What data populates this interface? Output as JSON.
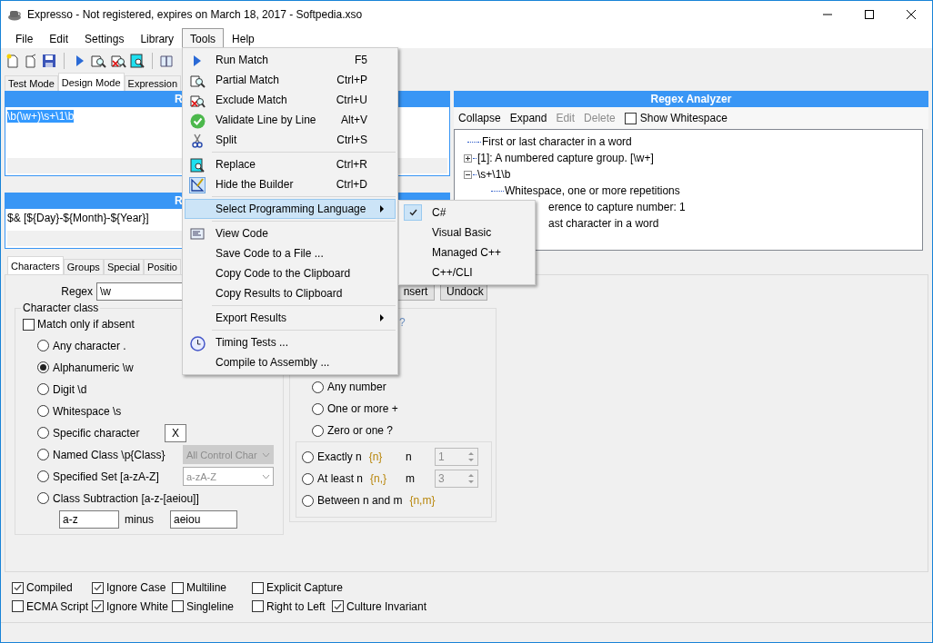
{
  "window": {
    "title": "Expresso - Not registered, expires on March 18, 2017 - Softpedia.xso"
  },
  "menu_bar": [
    {
      "label": "File",
      "selected": false
    },
    {
      "label": "Edit",
      "selected": false
    },
    {
      "label": "Settings",
      "selected": false
    },
    {
      "label": "Library",
      "selected": false
    },
    {
      "label": "Tools",
      "selected": true
    },
    {
      "label": "Help",
      "selected": false
    }
  ],
  "mode_tabs": [
    {
      "label": "Test Mode",
      "selected": false
    },
    {
      "label": "Design Mode",
      "selected": true
    },
    {
      "label": "Expression",
      "selected": false
    }
  ],
  "regex_panel": {
    "title": "R",
    "value": "\\b(\\w+)\\s+\\1\\b"
  },
  "replacement_panel": {
    "title": "R",
    "value": "$& [${Day}-${Month}-${Year}]"
  },
  "analyzer": {
    "title": "Regex Analyzer",
    "actions": [
      {
        "label": "Collapse",
        "disabled": false
      },
      {
        "label": "Expand",
        "disabled": false
      },
      {
        "label": "Edit",
        "disabled": true
      },
      {
        "label": "Delete",
        "disabled": true
      }
    ],
    "show_whitespace": {
      "label": "Show Whitespace",
      "checked": false
    },
    "tree": [
      {
        "label": "First or last character in a word"
      },
      {
        "label": "[1]: A numbered capture group. [\\w+]",
        "expanded": false
      },
      {
        "label": "\\s+\\1\\b",
        "expanded": true,
        "children": [
          {
            "label": "Whitespace, one or more repetitions",
            "kind": "plain"
          },
          {
            "label": "erence to capture number: 1",
            "kind": "covered"
          },
          {
            "label": "ast character in a word",
            "kind": "covered"
          }
        ]
      }
    ]
  },
  "builder": {
    "tabs": [
      {
        "label": "Characters",
        "selected": true
      },
      {
        "label": "Groups",
        "selected": false
      },
      {
        "label": "Special",
        "selected": false
      },
      {
        "label": "Positio",
        "selected": false
      }
    ],
    "regex_label": "Regex",
    "regex_value": "\\w",
    "buttons": [
      "nsert",
      "Undock"
    ],
    "character_class": {
      "title": "Character class",
      "absent": {
        "label": "Match only if absent",
        "checked": false
      },
      "options": [
        {
          "label": "Any character .",
          "selected": false,
          "kind": "plain"
        },
        {
          "label": "Alphanumeric \\w",
          "selected": true,
          "kind": "plain"
        },
        {
          "label": "Digit \\d",
          "selected": false,
          "kind": "plain"
        },
        {
          "label": "Whitespace \\s",
          "selected": false,
          "kind": "plain"
        },
        {
          "label": "Specific character",
          "selected": false,
          "kind": "text",
          "value": "X"
        },
        {
          "label": "Named Class \\p{Class}",
          "selected": false,
          "kind": "select",
          "value": "All Control Char",
          "disabled": true
        },
        {
          "label": "Specified Set [a-zA-Z]",
          "selected": false,
          "kind": "select",
          "value": "a-zA-Z",
          "disabled": false
        },
        {
          "label": "Class Subtraction [a-z-[aeiou]]",
          "selected": false,
          "kind": "subtraction",
          "from": "a-z",
          "joiner": "minus",
          "minus": "aeiou"
        }
      ]
    },
    "repeat": {
      "hint": "?",
      "options": [
        {
          "label": "Any number",
          "selected": false
        },
        {
          "label": "One or more +",
          "selected": false
        },
        {
          "label": "Zero or one ?",
          "selected": false
        }
      ],
      "bounds": [
        {
          "label": "Exactly n",
          "syntax": "{n}",
          "selected": false,
          "param": "n",
          "value": "1"
        },
        {
          "label": "At least n",
          "syntax": "{n,}",
          "selected": false,
          "param": "m",
          "value": "3"
        },
        {
          "label": "Between n and m",
          "syntax": "{n,m}",
          "selected": false
        }
      ]
    }
  },
  "options": [
    {
      "items": [
        {
          "label": "Compiled",
          "checked": true
        },
        {
          "label": "Ignore Case",
          "checked": true
        },
        {
          "label": "Multiline",
          "checked": false
        },
        {
          "label": "Explicit Capture",
          "checked": false
        }
      ]
    },
    {
      "items": [
        {
          "label": "ECMA Script",
          "checked": false
        },
        {
          "label": "Ignore White",
          "checked": true
        },
        {
          "label": "Singleline",
          "checked": false
        },
        {
          "label": "Right to Left",
          "checked": false
        },
        {
          "label": "Culture Invariant",
          "checked": true
        }
      ]
    }
  ],
  "tools_menu": [
    {
      "kind": "item",
      "label": "Run Match",
      "shortcut": "F5",
      "selected": false
    },
    {
      "kind": "item",
      "label": "Partial Match",
      "shortcut": "Ctrl+P",
      "selected": false
    },
    {
      "kind": "item",
      "label": "Exclude Match",
      "shortcut": "Ctrl+U",
      "selected": false
    },
    {
      "kind": "item",
      "label": "Validate Line by Line",
      "shortcut": "Alt+V",
      "selected": false
    },
    {
      "kind": "item",
      "label": "Split",
      "shortcut": "Ctrl+S",
      "selected": false
    },
    {
      "kind": "separator"
    },
    {
      "kind": "item",
      "label": "Replace",
      "shortcut": "Ctrl+R",
      "selected": false
    },
    {
      "kind": "item",
      "label": "Hide the Builder",
      "shortcut": "Ctrl+D",
      "selected": false
    },
    {
      "kind": "separator"
    },
    {
      "kind": "submenu",
      "label": "Select Programming Language",
      "selected": true
    },
    {
      "kind": "separator"
    },
    {
      "kind": "item",
      "label": "View Code",
      "selected": false
    },
    {
      "kind": "item",
      "label": "Save Code to a File ...",
      "selected": false
    },
    {
      "kind": "item",
      "label": "Copy Code to the Clipboard",
      "selected": false
    },
    {
      "kind": "item",
      "label": "Copy Results to Clipboard",
      "selected": false
    },
    {
      "kind": "separator"
    },
    {
      "kind": "submenu",
      "label": "Export Results",
      "selected": false
    },
    {
      "kind": "separator"
    },
    {
      "kind": "item",
      "label": "Timing Tests ...",
      "selected": false
    },
    {
      "kind": "item",
      "label": "Compile to Assembly ...",
      "selected": false
    }
  ],
  "language_menu": [
    {
      "label": "C#",
      "checked": true
    },
    {
      "label": "Visual Basic",
      "checked": false
    },
    {
      "label": "Managed C++",
      "checked": false
    },
    {
      "label": "C++/CLI",
      "checked": false
    }
  ]
}
